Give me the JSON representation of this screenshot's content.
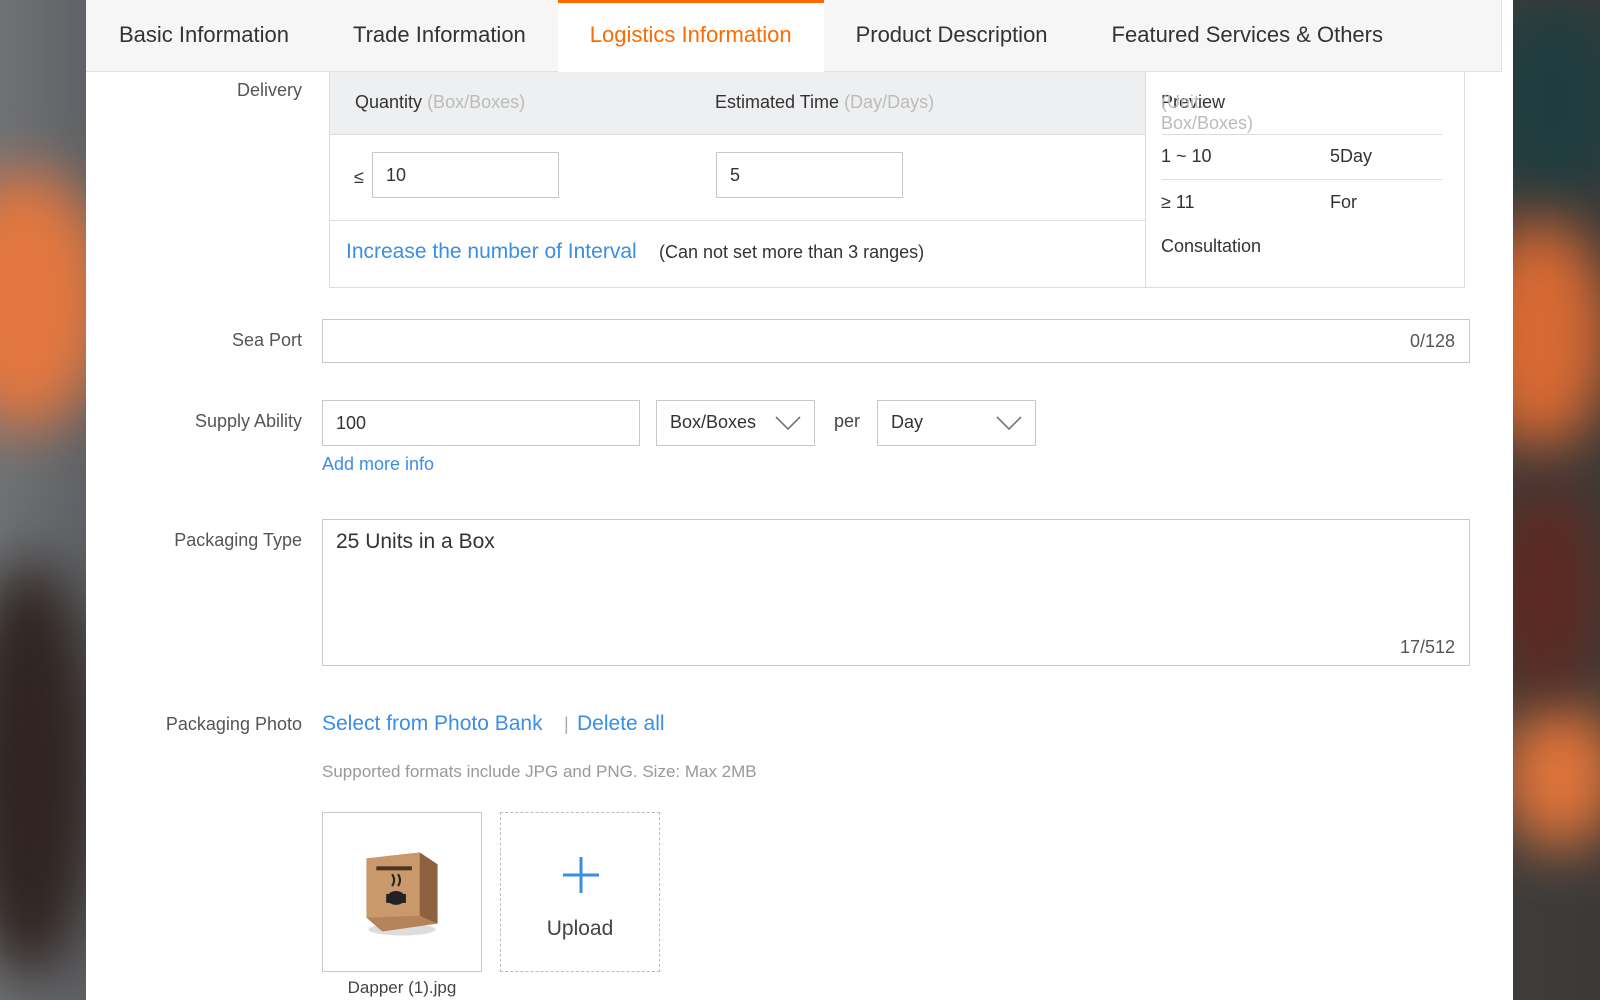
{
  "tabs": [
    {
      "label": "Basic Information",
      "active": false
    },
    {
      "label": "Trade Information",
      "active": false
    },
    {
      "label": "Logistics Information",
      "active": true
    },
    {
      "label": "Product Description",
      "active": false
    },
    {
      "label": "Featured Services & Others",
      "active": false
    }
  ],
  "delivery": {
    "label": "Delivery",
    "quantity_header": "Quantity",
    "quantity_unit": "(Box/Boxes)",
    "time_header": "Estimated Time",
    "time_unit": "(Day/Days)",
    "le_symbol": "≤",
    "quantity_value": "10",
    "time_value": "5",
    "add_interval_link": "Increase the number of Interval",
    "add_interval_note": "(Can not set more than 3 ranges)",
    "preview_title": "Preview",
    "preview_unit": "(Unit: Box/Boxes)",
    "preview_rows": [
      {
        "range": "1 ~ 10",
        "time": "5Day"
      },
      {
        "range": "≥ 11",
        "time": "For"
      }
    ],
    "preview_wrap": "Consultation"
  },
  "sea_port": {
    "label": "Sea Port",
    "value": "",
    "counter": "0/128"
  },
  "supply_ability": {
    "label": "Supply Ability",
    "value": "100",
    "unit": "Box/Boxes",
    "per": "per",
    "period": "Day",
    "add_more": "Add more info"
  },
  "packaging_type": {
    "label": "Packaging Type",
    "value": "25 Units in a Box",
    "counter": "17/512"
  },
  "packaging_photo": {
    "label": "Packaging Photo",
    "select_link": "Select from Photo Bank",
    "separator": "|",
    "delete_link": "Delete all",
    "hint": "Supported formats include JPG and PNG. Size: Max 2MB",
    "file_name": "Dapper (1).jpg",
    "upload_label": "Upload"
  },
  "colors": {
    "accent": "#ff6a00",
    "link": "#3a8ee6"
  }
}
